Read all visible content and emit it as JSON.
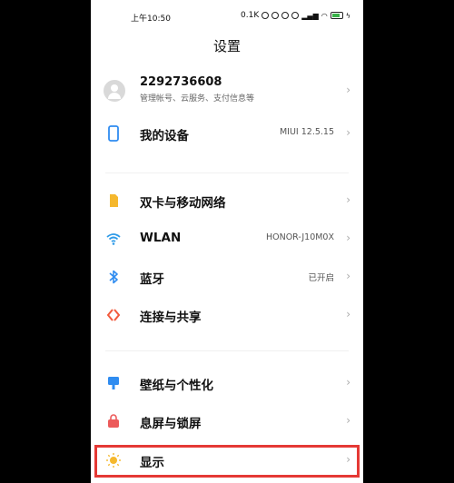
{
  "status_bar": {
    "time": "上午10:50",
    "speed": "0.1K"
  },
  "header": {
    "title": "设置"
  },
  "account": {
    "id": "2292736608",
    "subtitle": "管理帐号、云服务、支付信息等"
  },
  "rows": [
    {
      "label": "我的设备",
      "value": "MIUI 12.5.15",
      "icon": "device-icon",
      "color": "#2f8cf0"
    },
    {
      "label": "双卡与移动网络",
      "value": "",
      "icon": "sim-card-icon",
      "color": "#f5b82e"
    },
    {
      "label": "WLAN",
      "value": "HONOR-J10M0X",
      "icon": "wifi-icon",
      "color": "#2f9be8"
    },
    {
      "label": "蓝牙",
      "value": "已开启",
      "icon": "bluetooth-icon",
      "color": "#2f8cf0"
    },
    {
      "label": "连接与共享",
      "value": "",
      "icon": "connection-share-icon",
      "color": "#f25a3c"
    },
    {
      "label": "壁纸与个性化",
      "value": "",
      "icon": "wallpaper-icon",
      "color": "#2f8cf0"
    },
    {
      "label": "息屏与锁屏",
      "value": "",
      "icon": "lock-icon",
      "color": "#ec5a5a"
    },
    {
      "label": "显示",
      "value": "",
      "icon": "sun-icon",
      "color": "#f5b82e"
    }
  ]
}
